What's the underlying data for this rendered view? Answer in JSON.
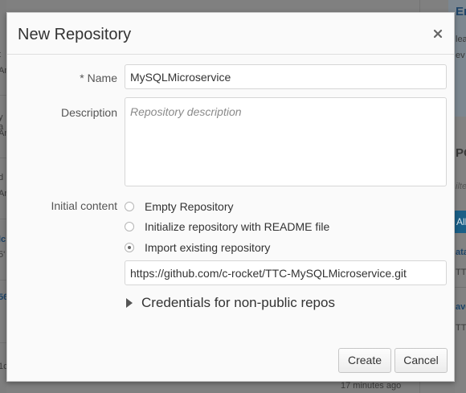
{
  "dialog": {
    "title": "New Repository",
    "close_icon": "close-icon"
  },
  "form": {
    "name": {
      "required_marker": "*",
      "label": "Name",
      "value": "MySQLMicroservice"
    },
    "description": {
      "label": "Description",
      "placeholder": "Repository description"
    },
    "initial_content": {
      "label": "Initial content",
      "options": [
        {
          "label": "Empty Repository",
          "checked": false
        },
        {
          "label": "Initialize repository with README file",
          "checked": false
        },
        {
          "label": "Import existing repository",
          "checked": true
        }
      ],
      "import_url": "https://github.com/c-rocket/TTC-MySQLMicroservice.git"
    },
    "credentials": {
      "label": "Credentials for non-public repos",
      "icon": "triangle-right-icon"
    }
  },
  "buttons": {
    "create": "Create",
    "cancel": "Cancel"
  },
  "background": {
    "timestamp": "17 minutes ago",
    "left_fragments": [
      "t",
      "Ar",
      "y a",
      "Ar",
      "d",
      "Ar",
      "lc",
      "5'",
      "56",
      "1c"
    ],
    "right_fragments": [
      "Ena",
      "lea",
      "ev",
      "PO",
      "ilte",
      "All",
      "ata",
      "TTF",
      "ave",
      "TTF"
    ]
  }
}
